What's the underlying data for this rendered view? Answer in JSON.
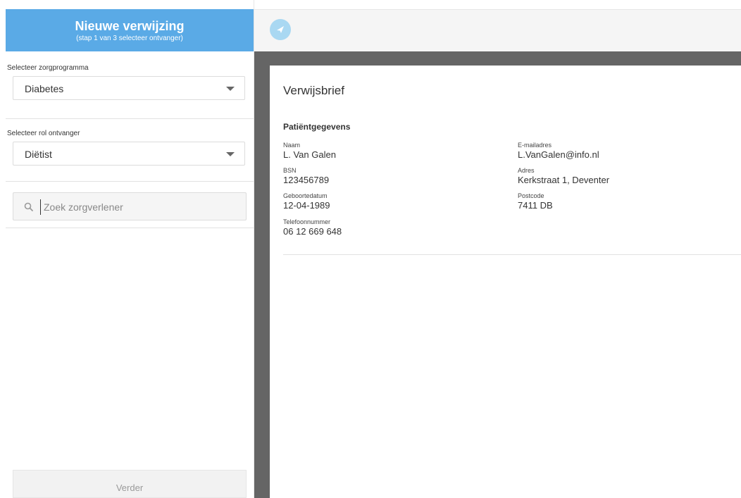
{
  "header": {
    "title": "Nieuwe verwijzing",
    "subtitle": "(stap 1 van 3 selecteer ontvanger)"
  },
  "zorgprogramma": {
    "label": "Selecteer zorgprogramma",
    "value": "Diabetes"
  },
  "rol": {
    "label": "Selecteer rol ontvanger",
    "value": "Diëtist"
  },
  "search": {
    "placeholder": "Zoek zorgverlener"
  },
  "footer": {
    "verder_label": "Verder"
  },
  "document": {
    "title": "Verwijsbrief",
    "section_title": "Patiëntgegevens",
    "left_fields": [
      {
        "label": "Naam",
        "value": "L. Van Galen"
      },
      {
        "label": "BSN",
        "value": "123456789"
      },
      {
        "label": "Geboortedatum",
        "value": "12-04-1989"
      },
      {
        "label": "Telefoonnummer",
        "value": "06 12 669 648"
      }
    ],
    "right_fields": [
      {
        "label": "E-mailadres",
        "value": "L.VanGalen@info.nl"
      },
      {
        "label": "Adres",
        "value": "Kerkstraat 1, Deventer"
      },
      {
        "label": "Postcode",
        "value": "7411 DB"
      }
    ]
  },
  "icons": {
    "send": "paper-plane-icon",
    "search": "search-icon",
    "dropdown": "chevron-down-icon"
  },
  "colors": {
    "header_bg": "#5aaae6",
    "send_button": "#a9d8f2",
    "doc_backdrop": "#656565"
  }
}
